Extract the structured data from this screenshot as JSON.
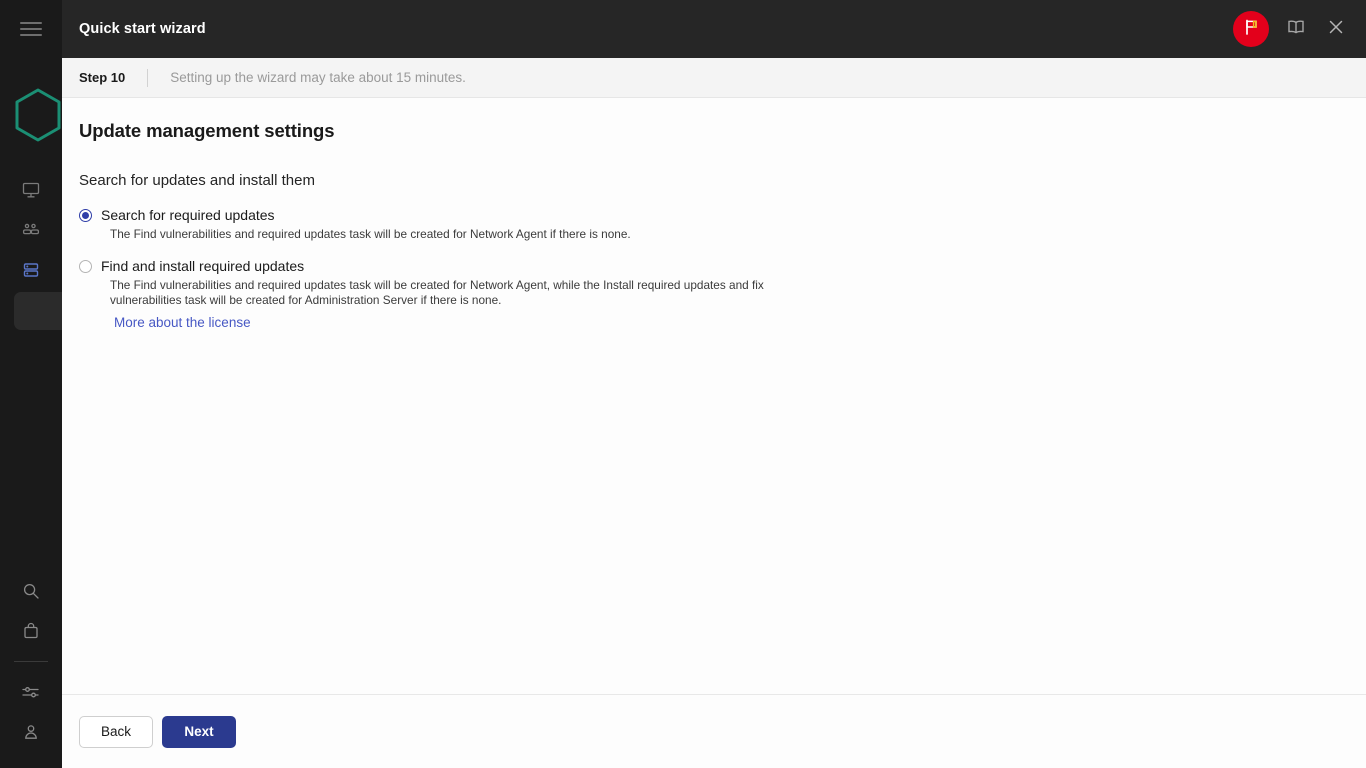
{
  "window": {
    "title": "Quick start wizard",
    "menu_icon": "hamburger-icon",
    "notification_icon": "flag-icon",
    "help_icon": "book-icon",
    "close_icon": "close-icon"
  },
  "step": {
    "label": "Step 10",
    "note": "Setting up the wizard may take about 15 minutes."
  },
  "main": {
    "page_title": "Update management settings",
    "section_title": "Search for updates and install them",
    "options": [
      {
        "label": "Search for required updates",
        "description": "The Find vulnerabilities and required updates task will be created for Network Agent if there is none.",
        "selected": true
      },
      {
        "label": "Find and install required updates",
        "description": "The Find vulnerabilities and required updates task will be created for Network Agent, while the Install required updates and fix vulnerabilities task will be created for Administration Server if there is none.",
        "selected": false
      }
    ],
    "link_label": "More about the license"
  },
  "footer": {
    "back_label": "Back",
    "next_label": "Next"
  },
  "sidebar": {
    "logo": "hexagon-logo",
    "items": [
      {
        "name": "monitoring",
        "icon": "monitor-icon",
        "active": false
      },
      {
        "name": "devices",
        "icon": "users-icon",
        "active": false
      },
      {
        "name": "servers",
        "icon": "server-stack-icon",
        "active": true
      }
    ],
    "bottom_items": [
      {
        "name": "search",
        "icon": "search-icon"
      },
      {
        "name": "marketplace",
        "icon": "bag-icon"
      },
      {
        "name": "settings",
        "icon": "sliders-icon"
      },
      {
        "name": "account",
        "icon": "user-icon"
      }
    ]
  },
  "colors": {
    "rail_bg": "#1a1a1a",
    "topbar_bg": "#262626",
    "accent_blue": "#2b3a8f",
    "link_blue": "#4758c4",
    "badge_red": "#e3001b",
    "logo_green": "#1b8f74",
    "active_icon_blue": "#5b76c8"
  }
}
